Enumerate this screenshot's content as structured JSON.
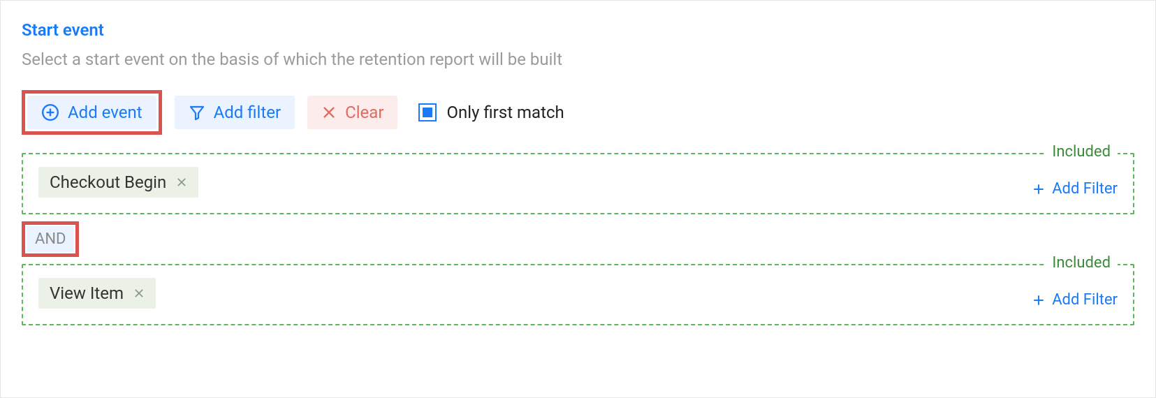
{
  "section": {
    "title": "Start event",
    "description": "Select a start event on the basis of which the retention report will be built"
  },
  "toolbar": {
    "add_event": "Add event",
    "add_filter": "Add filter",
    "clear": "Clear",
    "only_first_match": "Only first match",
    "only_first_match_checked": true
  },
  "operator": "AND",
  "groups": [
    {
      "legend": "Included",
      "chip": "Checkout Begin",
      "add_filter": "Add Filter"
    },
    {
      "legend": "Included",
      "chip": "View Item",
      "add_filter": "Add Filter"
    }
  ]
}
